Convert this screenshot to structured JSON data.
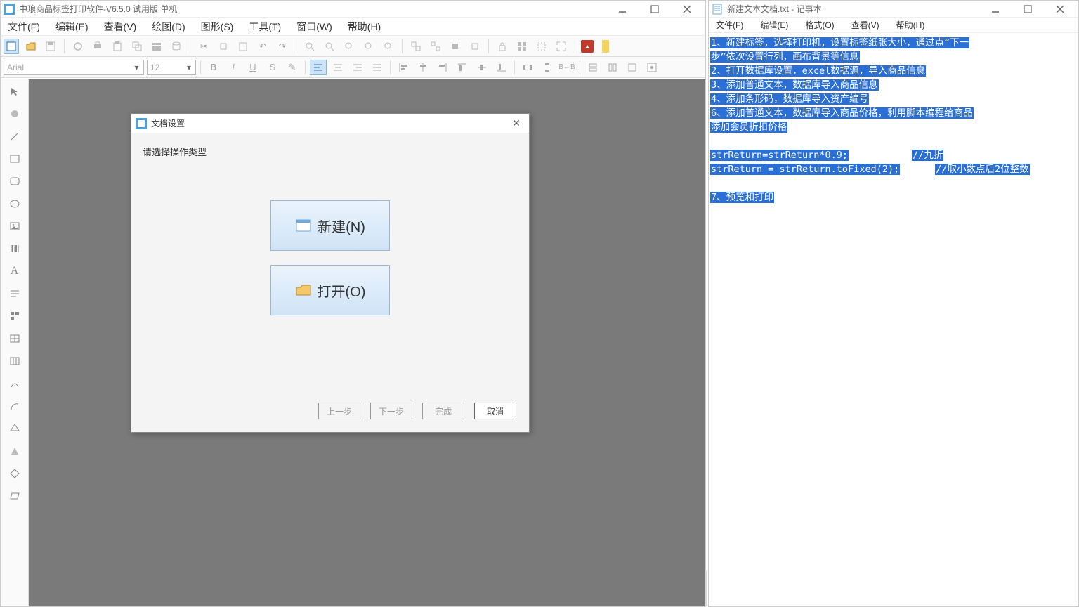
{
  "left_app": {
    "title": "中琅商品标签打印软件-V6.5.0 试用版 单机",
    "menus": [
      "文件(F)",
      "编辑(E)",
      "查看(V)",
      "绘图(D)",
      "图形(S)",
      "工具(T)",
      "窗口(W)",
      "帮助(H)"
    ],
    "font_name": "Arial",
    "font_size": "12"
  },
  "dialog": {
    "title": "文档设置",
    "prompt": "请选择操作类型",
    "new_btn": "新建(N)",
    "open_btn": "打开(O)",
    "prev": "上一步",
    "next": "下一步",
    "finish": "完成",
    "cancel": "取消"
  },
  "notepad": {
    "title": "新建文本文档.txt - 记事本",
    "menus": [
      "文件(F)",
      "编辑(E)",
      "格式(O)",
      "查看(V)",
      "帮助(H)"
    ],
    "lines": {
      "l1a": "1、新建标签，选择打印机，设置标签纸张大小，通过点“下一",
      "l1b": "步”依次设置行列，画布背景等信息",
      "l2": "2、打开数据库设置，excel数据源，导入商品信息",
      "l3": "3、添加普通文本，数据库导入商品信息",
      "l4": "4、添加条形码，数据库导入资产编号",
      "l6a": "6、添加普通文本，数据库导入商品价格，利用脚本编程给商品",
      "l6b": "添加会员折扣价格",
      "code1a": "strReturn=strReturn*0.9;",
      "code1b": "//九折",
      "code2a": "strReturn = strReturn.toFixed(2);",
      "code2b": "//取小数点后2位整数",
      "l7": "7、预览和打印"
    }
  }
}
